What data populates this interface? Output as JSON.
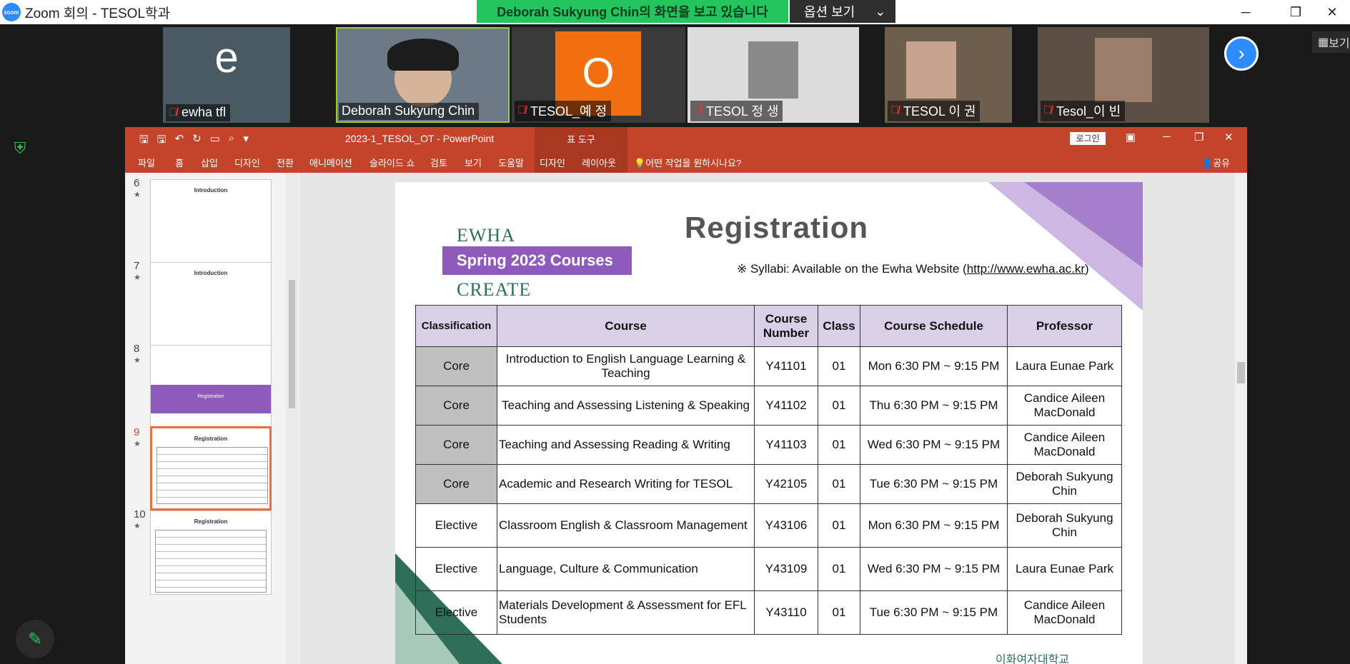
{
  "zoom": {
    "title": "Zoom 회의 - TESOL학과",
    "logo": "zoom",
    "share_banner": "Deborah Sukyung Chin의 화면을 보고 있습니다",
    "options_label": "옵션 보기",
    "view_label": "보기"
  },
  "participants": [
    {
      "name": "ewha tfl",
      "avatar_letter": "e",
      "muted": true
    },
    {
      "name": "Deborah Sukyung Chin",
      "muted": false
    },
    {
      "name": "TESOL_예 정",
      "avatar_letter": "O",
      "muted": true
    },
    {
      "name": "TESOL 정 생",
      "muted": true
    },
    {
      "name": "TESOL 이 권",
      "muted": true
    },
    {
      "name": "Tesol_이 빈",
      "muted": true
    }
  ],
  "ppt": {
    "doc_title": "2023-1_TESOL_OT  -  PowerPoint",
    "tool_tab": "표 도구",
    "login": "로그인",
    "share": "공유",
    "ribbon_tabs": [
      "파일",
      "홈",
      "삽입",
      "디자인",
      "전환",
      "애니메이션",
      "슬라이드 쇼",
      "검토",
      "보기",
      "도움말",
      "디자인",
      "레이아웃"
    ],
    "tell_me": "어떤 작업을 원하시나요?",
    "thumbnails": [
      {
        "num": "6",
        "title": "Introduction"
      },
      {
        "num": "7",
        "title": "Introduction"
      },
      {
        "num": "8",
        "title": "Registration"
      },
      {
        "num": "9",
        "title": "Registration",
        "active": true
      },
      {
        "num": "10",
        "title": "Registration"
      }
    ]
  },
  "slide": {
    "title": "Registration",
    "logo_line1": "EWHA",
    "logo_line2": "WE CREATE",
    "badge": "Spring 2023 Courses",
    "syllabi_prefix": "※ Syllabi:  Available on the Ewha Website (",
    "syllabi_url": "http://www.ewha.ac.kr",
    "syllabi_suffix": ")",
    "university": "이화여자대학교",
    "table": {
      "headers": [
        "Classification",
        "Course",
        "Course Number",
        "Class",
        "Course Schedule",
        "Professor"
      ],
      "rows": [
        [
          "Core",
          "Introduction to English Language Learning & Teaching",
          "Y41101",
          "01",
          "Mon 6:30 PM ~ 9:15 PM",
          "Laura Eunae Park"
        ],
        [
          "Core",
          "Teaching and Assessing Listening & Speaking",
          "Y41102",
          "01",
          "Thu 6:30 PM ~ 9:15 PM",
          "Candice Aileen MacDonald"
        ],
        [
          "Core",
          "Teaching and Assessing Reading & Writing",
          "Y41103",
          "01",
          "Wed 6:30 PM ~ 9:15 PM",
          "Candice Aileen MacDonald"
        ],
        [
          "Core",
          "Academic and Research Writing for TESOL",
          "Y42105",
          "01",
          "Tue 6:30 PM ~ 9:15 PM",
          "Deborah Sukyung Chin"
        ],
        [
          "Elective",
          "Classroom English & Classroom Management",
          "Y43106",
          "01",
          "Mon 6:30 PM ~ 9:15 PM",
          "Deborah Sukyung Chin"
        ],
        [
          "Elective",
          "Language, Culture & Communication",
          "Y43109",
          "01",
          "Wed 6:30 PM ~ 9:15 PM",
          "Laura Eunae Park"
        ],
        [
          "Elective",
          "Materials Development & Assessment for EFL Students",
          "Y43110",
          "01",
          "Tue 6:30 PM ~ 9:15 PM",
          "Candice Aileen MacDonald"
        ]
      ]
    }
  },
  "colors": {
    "zoom_green": "#22c55e",
    "ppt_red": "#c4432b",
    "slide_purple": "#8e5bbd",
    "header_purple": "#d9cfe6"
  }
}
